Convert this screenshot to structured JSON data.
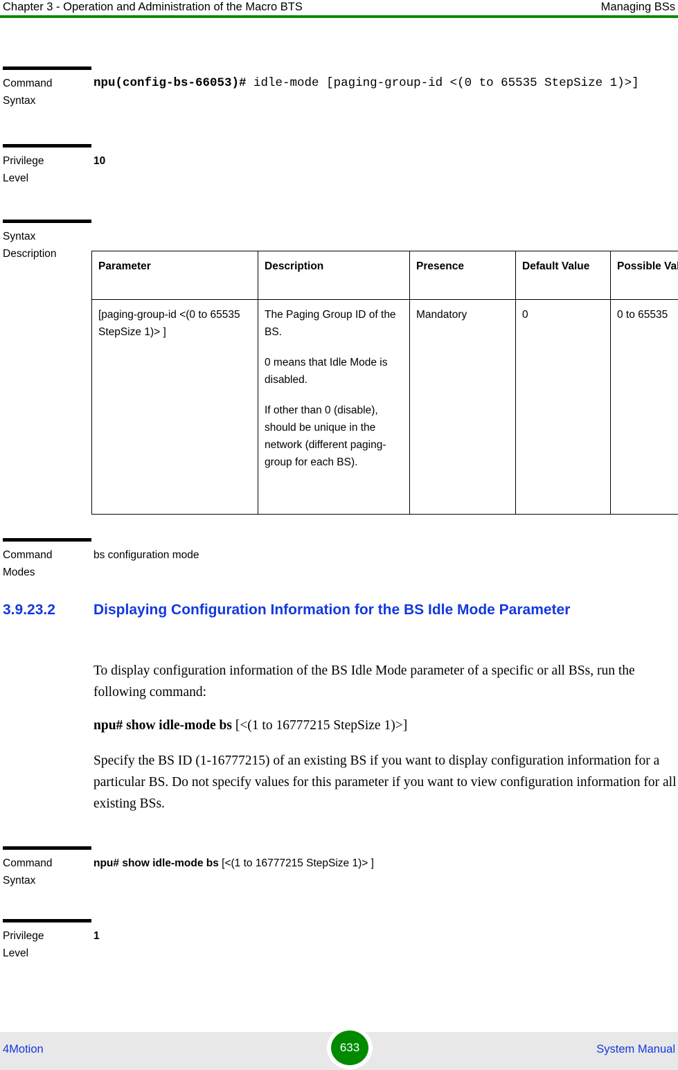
{
  "header": {
    "left": "Chapter 3 - Operation and Administration of the Macro BTS",
    "right": "Managing BSs",
    "rule_color": "#0a8a0a"
  },
  "blocks": {
    "command_syntax_1": {
      "label_line1": "Command",
      "label_line2": "Syntax",
      "value_bold": "npu(config-bs-66053)#",
      "value_rest": " idle-mode [paging-group-id <(0 to 65535 StepSize 1)>]"
    },
    "privilege_level_1": {
      "label_line1": "Privilege",
      "label_line2": "Level",
      "value": "10"
    },
    "syntax_description": {
      "label_line1": "Syntax",
      "label_line2": "Description"
    },
    "command_modes": {
      "label_line1": "Command",
      "label_line2": "Modes",
      "value": "bs configuration mode"
    },
    "command_syntax_2": {
      "label_line1": "Command",
      "label_line2": "Syntax",
      "value_bold": "npu# show idle-mode bs",
      "value_rest": " [<(1 to 16777215 StepSize 1)> ]"
    },
    "privilege_level_2": {
      "label_line1": "Privilege",
      "label_line2": "Level",
      "value": "1"
    }
  },
  "param_table": {
    "headers": [
      "Parameter",
      "Description",
      "Presence",
      "Default Value",
      "Possible Values"
    ],
    "rows": [
      {
        "parameter": "[paging-group-id <(0 to 65535 StepSize 1)> ]",
        "description_paragraphs": [
          "The Paging Group ID of the BS.",
          "0 means that Idle Mode is disabled.",
          "If other than 0 (disable), should be unique in the network (different paging-group for each BS)."
        ],
        "presence": "Mandatory",
        "default_value": "0",
        "possible_values": "0 to 65535"
      }
    ]
  },
  "section": {
    "number": "3.9.23.2",
    "title": "Displaying Configuration Information for the BS Idle Mode Parameter",
    "color": "#1338e0"
  },
  "paragraphs": {
    "intro": "To display configuration information of the BS Idle Mode parameter of a specific or all BSs, run the following command:",
    "command_bold": "npu# show idle-mode bs",
    "command_rest": " [<(1 to 16777215 StepSize 1)>]",
    "detail": "Specify the BS ID (1-16777215) of an existing BS if you want to display configuration information for a particular BS. Do not specify values for this parameter if you want to view configuration information for all existing BSs."
  },
  "footer": {
    "left": "4Motion",
    "page_number": "633",
    "right": "System Manual",
    "badge_color": "#008a00",
    "background": "#e8e8e8",
    "link_color": "#1338e0"
  }
}
